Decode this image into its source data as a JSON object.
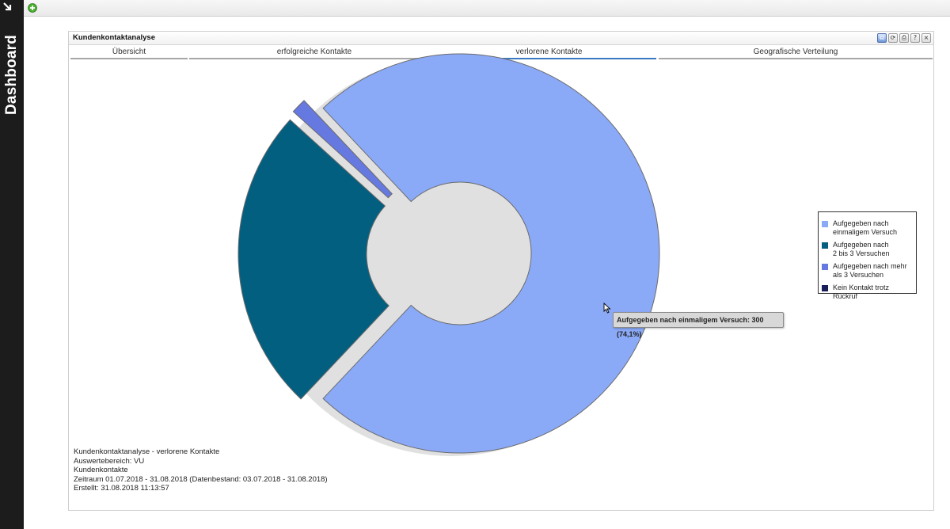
{
  "sidebar": {
    "title": "Dashboard"
  },
  "portlet": {
    "title": "Kundenkontaktanalyse",
    "header_buttons": [
      {
        "icon": "copy-icon",
        "glyph": "⧉"
      },
      {
        "icon": "refresh-icon",
        "glyph": "⟳"
      },
      {
        "icon": "print-icon",
        "glyph": "⎙"
      },
      {
        "icon": "help-icon",
        "glyph": "?"
      },
      {
        "icon": "close-icon",
        "glyph": "×"
      }
    ]
  },
  "tabs": [
    {
      "label": "Übersicht",
      "active": false
    },
    {
      "label": "erfolgreiche Kontakte",
      "active": false
    },
    {
      "label": "verlorene Kontakte",
      "active": true
    },
    {
      "label": "Geografische Verteilung",
      "active": false
    }
  ],
  "colors": {
    "tab_active": "#3a78c2",
    "series": [
      "#8aa9f7",
      "#025f80",
      "#6679e0",
      "#1a1f5a"
    ]
  },
  "chart_data": {
    "type": "pie",
    "title": "",
    "donut": true,
    "exploded": true,
    "slices": [
      {
        "name": "Aufgegeben nach einmaligem Versuch",
        "value": 300,
        "percent": 74.1
      },
      {
        "name": "Aufgegeben nach 2 bis 3 Versuchen",
        "value": 100,
        "percent": 24.7
      },
      {
        "name": "Aufgegeben nach mehr als 3 Versuchen",
        "value": 5,
        "percent": 1.2
      },
      {
        "name": "Kein Kontakt trotz Rückruf",
        "value": 0,
        "percent": 0
      }
    ],
    "legend": {
      "placement": "right",
      "items": [
        {
          "line1": "Aufgegeben nach",
          "line2": "einmaligem Versuch"
        },
        {
          "line1": "Aufgegeben nach",
          "line2": "2 bis 3 Versuchen"
        },
        {
          "line1": "Aufgegeben nach mehr",
          "line2": "als 3 Versuchen"
        },
        {
          "line1": "Kein Kontakt trotz Rückruf",
          "line2": ""
        }
      ]
    }
  },
  "tooltip": {
    "text": "Aufgegeben nach einmaligem Versuch: 300 (74,1%)"
  },
  "info": {
    "line1": "Kundenkontaktanalyse - verlorene Kontakte",
    "line2": "Auswertebereich: VU",
    "line3": "Kundenkontakte",
    "line4": "Zeitraum 01.07.2018 - 31.08.2018 (Datenbestand: 03.07.2018 - 31.08.2018)",
    "line5": "Erstellt: 31.08.2018 11:13:57"
  }
}
